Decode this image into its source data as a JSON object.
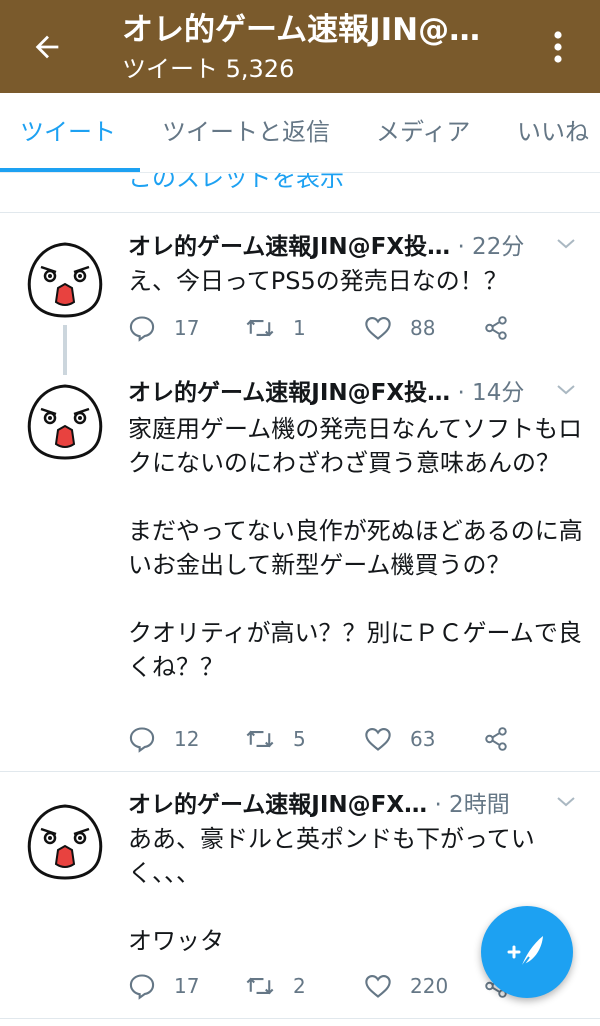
{
  "header": {
    "title": "オレ的ゲーム速報JIN@…",
    "subtitle": "ツイート 5,326"
  },
  "tabs": [
    {
      "label": "ツイート",
      "active": true
    },
    {
      "label": "ツイートと返信",
      "active": false
    },
    {
      "label": "メディア",
      "active": false
    },
    {
      "label": "いいね",
      "active": false
    }
  ],
  "thread_link": "このスレッドを表示",
  "tweets": [
    {
      "name": "オレ的ゲーム速報JIN@FX投…",
      "time": "· 22分",
      "text": "え、今日ってPS5の発売日なの！？",
      "replies": "17",
      "retweets": "1",
      "likes": "88"
    },
    {
      "name": "オレ的ゲーム速報JIN@FX投…",
      "time": "· 14分",
      "text": "家庭用ゲーム機の発売日なんてソフトもロクにないのにわざわざ買う意味あんの？\n\nまだやってない良作が死ぬほどあるのに高いお金出して新型ゲーム機買うの？\n\nクオリティが高い？？別にＰＣゲームで良くね？？",
      "replies": "12",
      "retweets": "5",
      "likes": "63"
    },
    {
      "name": "オレ的ゲーム速報JIN@FX…",
      "time": "· 2時間",
      "text": "ああ、豪ドルと英ポンドも下がっていく、、、\n\nオワッタ",
      "replies": "17",
      "retweets": "2",
      "likes": "220"
    }
  ],
  "colors": {
    "header_bg": "#7a5a2c",
    "accent": "#1da1f2",
    "muted": "#657786"
  }
}
